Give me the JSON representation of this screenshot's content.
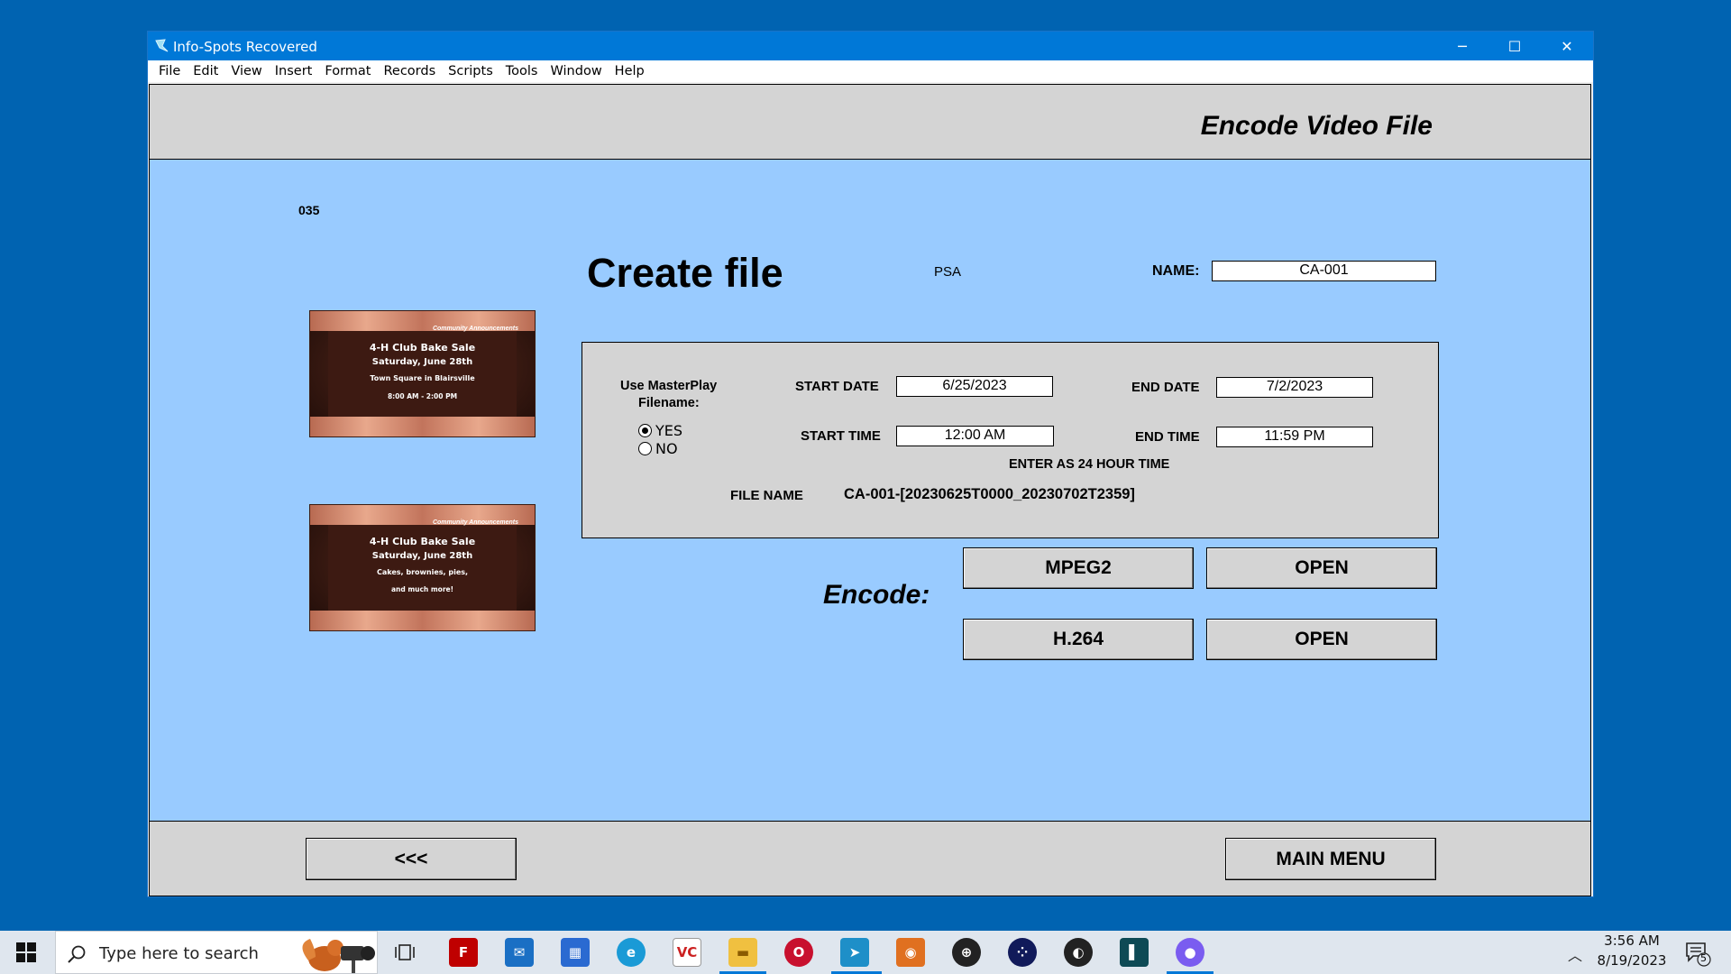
{
  "window": {
    "title": "Info-Spots Recovered",
    "controls": {
      "minimize": "─",
      "maximize": "☐",
      "close": "✕"
    }
  },
  "menu": [
    "File",
    "Edit",
    "View",
    "Insert",
    "Format",
    "Records",
    "Scripts",
    "Tools",
    "Window",
    "Help"
  ],
  "header": {
    "title": "Encode Video File"
  },
  "record": {
    "number": "035"
  },
  "thumbnails": [
    {
      "banner": "Community Announcements",
      "lines": [
        "4-H Club Bake Sale",
        "Saturday, June 28th",
        "Town Square in Blairsville",
        "8:00 AM - 2:00 PM"
      ]
    },
    {
      "banner": "Community Announcements",
      "lines": [
        "4-H Club Bake Sale",
        "Saturday, June 28th",
        "Cakes, brownies, pies,",
        "and much more!"
      ]
    }
  ],
  "form": {
    "heading": "Create file",
    "category": "PSA",
    "name_label": "NAME:",
    "name_value": "CA-001",
    "masterplay_label_1": "Use MasterPlay",
    "masterplay_label_2": "Filename:",
    "radio_yes": "YES",
    "radio_no": "NO",
    "radio_selected": "YES",
    "start_date_label": "START DATE",
    "start_date": "6/25/2023",
    "end_date_label": "END DATE",
    "end_date": "7/2/2023",
    "start_time_label": "START TIME",
    "start_time": "12:00 AM",
    "end_time_label": "END TIME",
    "end_time": "11:59 PM",
    "hint": "ENTER AS 24 HOUR TIME",
    "file_name_label": "FILE NAME",
    "file_name": "CA-001-[20230625T0000_20230702T2359]"
  },
  "encode": {
    "label": "Encode:",
    "mpeg2": "MPEG2",
    "h264": "H.264",
    "open": "OPEN"
  },
  "footer": {
    "back": "<<<",
    "main_menu": "MAIN MENU"
  },
  "taskbar": {
    "search_placeholder": "Type here to search",
    "time": "3:56 AM",
    "date": "8/19/2023",
    "notification_count": "5",
    "apps": [
      "filezilla-icon",
      "mail-icon",
      "store-icon",
      "edge-icon",
      "vc-icon",
      "file-explorer-icon",
      "opera-icon",
      "info-spots-icon",
      "app-eye-icon",
      "globe-icon",
      "dots-app-icon",
      "obs-icon",
      "teal-app-icon",
      "paint-icon"
    ]
  }
}
